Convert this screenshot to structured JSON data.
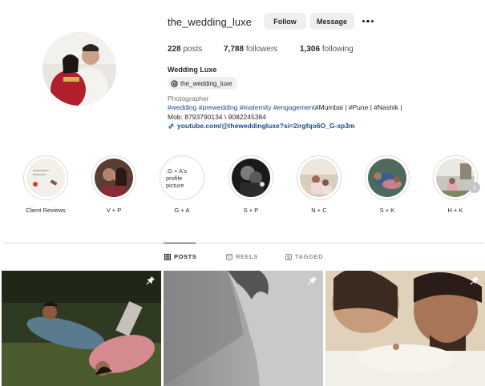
{
  "profile": {
    "username": "the_wedding_luxe",
    "follow_label": "Follow",
    "message_label": "Message",
    "posts_count": "228",
    "posts_label": "posts",
    "followers_count": "7,788",
    "followers_label": "followers",
    "following_count": "1,306",
    "following_label": "following",
    "full_name": "Wedding Luxe",
    "threads_handle": "the_wedding_luxe",
    "category": "Photographer",
    "bio_tags": [
      "#wedding",
      "#prewedding",
      "#maternity",
      "#engagement"
    ],
    "bio_plain": "#Mumbai | #Pune | #Nashik |",
    "bio_phone": "Mob: 8793790134 \\ 9082245384",
    "link": "youtube.com/@theweddingluxe?si=2irgfqo6O_G-xp3m"
  },
  "highlights": [
    {
      "label": "Client Reviews"
    },
    {
      "label": "V + P"
    },
    {
      "label": "G + A",
      "image_text": ".G + A's profile picture"
    },
    {
      "label": "S + P"
    },
    {
      "label": "N + C"
    },
    {
      "label": "S + K"
    },
    {
      "label": "H + K"
    }
  ],
  "tabs": [
    {
      "label": "POSTS",
      "active": true
    },
    {
      "label": "REELS",
      "active": false
    },
    {
      "label": "TAGGED",
      "active": false
    }
  ],
  "icons": {
    "more": "more-icon",
    "threads": "threads-icon",
    "link": "link-icon",
    "posts_tab": "grid-icon",
    "reels_tab": "reels-icon",
    "tagged_tab": "tagged-icon",
    "pinned": "pin-icon",
    "next": "chevron-right-icon"
  },
  "colors": {
    "button_bg": "#efefef",
    "link": "#1b4a8c",
    "muted": "#737373",
    "divider": "#dbdbdb"
  }
}
